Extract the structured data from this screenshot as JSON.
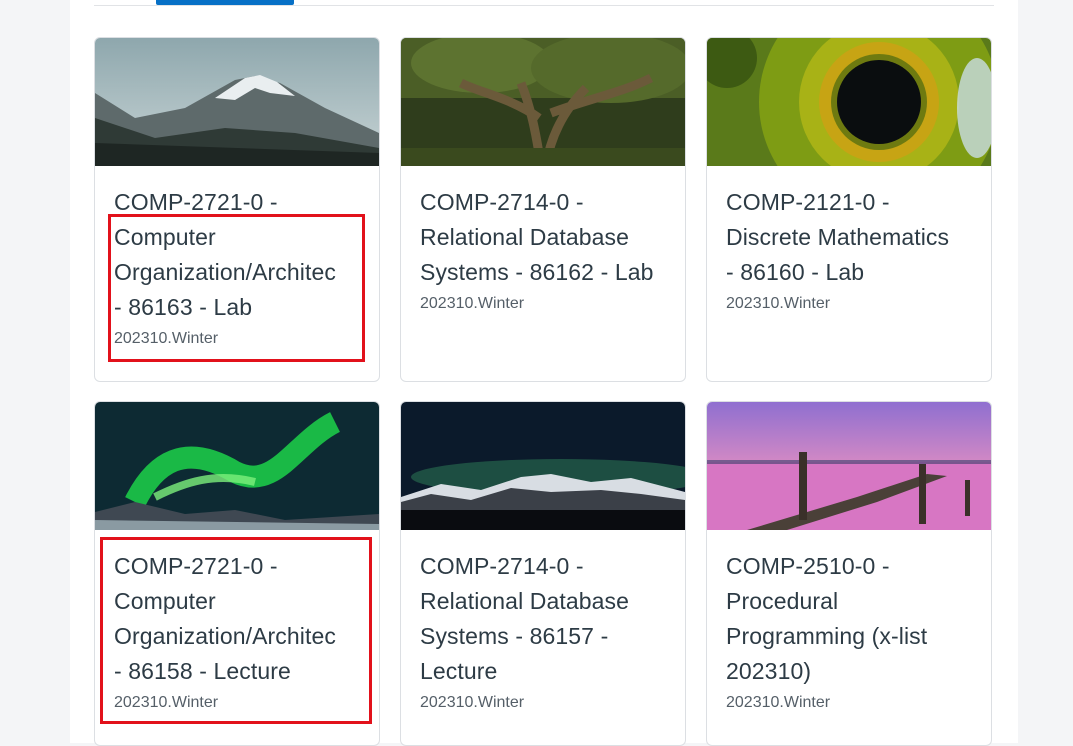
{
  "tabs": {
    "active_indicator_color": "#0770c6"
  },
  "highlight_color": "#e2111b",
  "cards": [
    {
      "title": "COMP-2721-0 -\nComputer\nOrganization/Architec\n- 86163 - Lab",
      "term": "202310.Winter",
      "image": "mountain-peak-image"
    },
    {
      "title": "COMP-2714-0 -\nRelational Database\nSystems - 86162 - Lab",
      "term": "202310.Winter",
      "image": "forest-tree-image"
    },
    {
      "title": "COMP-2121-0 -\nDiscrete Mathematics\n- 86160 - Lab",
      "term": "202310.Winter",
      "image": "eye-iris-image"
    },
    {
      "title": "COMP-2721-0 -\nComputer\nOrganization/Architec\n- 86158 - Lecture",
      "term": "202310.Winter",
      "image": "aurora-green-image"
    },
    {
      "title": "COMP-2714-0 -\nRelational Database\nSystems - 86157 -\nLecture",
      "term": "202310.Winter",
      "image": "aurora-mountains-image"
    },
    {
      "title": "COMP-2510-0 -\nProcedural\nProgramming (x-list\n202310)",
      "term": "202310.Winter",
      "image": "pier-sunset-image"
    }
  ]
}
